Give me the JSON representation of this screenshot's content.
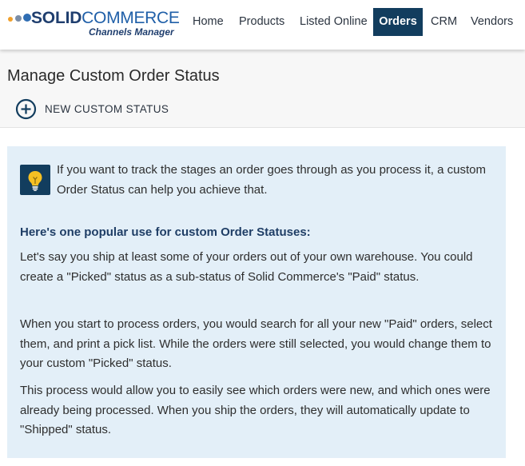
{
  "brand": {
    "name_bold": "SOLID",
    "name_light": "COMMERCE",
    "subtitle": "Channels Manager",
    "dot_colors": [
      "#f0a02c",
      "#7b8da6",
      "#2f6db3"
    ]
  },
  "nav": {
    "items": [
      "Home",
      "Products",
      "Listed Online",
      "Orders",
      "CRM",
      "Vendors"
    ],
    "active": "Orders",
    "active_color": "#123d5e"
  },
  "page": {
    "title": "Manage Custom Order Status",
    "new_button": "NEW CUSTOM STATUS"
  },
  "info": {
    "icon": "lightbulb-icon",
    "background_color": "#e3eff8",
    "intro": "If you want to track the stages an order goes through as you process it, a custom Order Status can help you achieve that.",
    "heading": "Here's one popular use for custom Order Statuses:",
    "paragraphs": [
      "Let's say you ship at least some of your orders out of your own warehouse. You could create a \"Picked\" status as a sub-status of Solid Commerce's \"Paid\" status.",
      "When you start to process orders, you would search for all your new \"Paid\" orders, select them, and print a pick list. While the orders were still selected, you would change them to your custom \"Picked\" status.",
      "This process would allow you to easily see which orders were new, and which ones were already being processed. When you ship the orders, they will automatically update to \"Shipped\" status."
    ]
  }
}
